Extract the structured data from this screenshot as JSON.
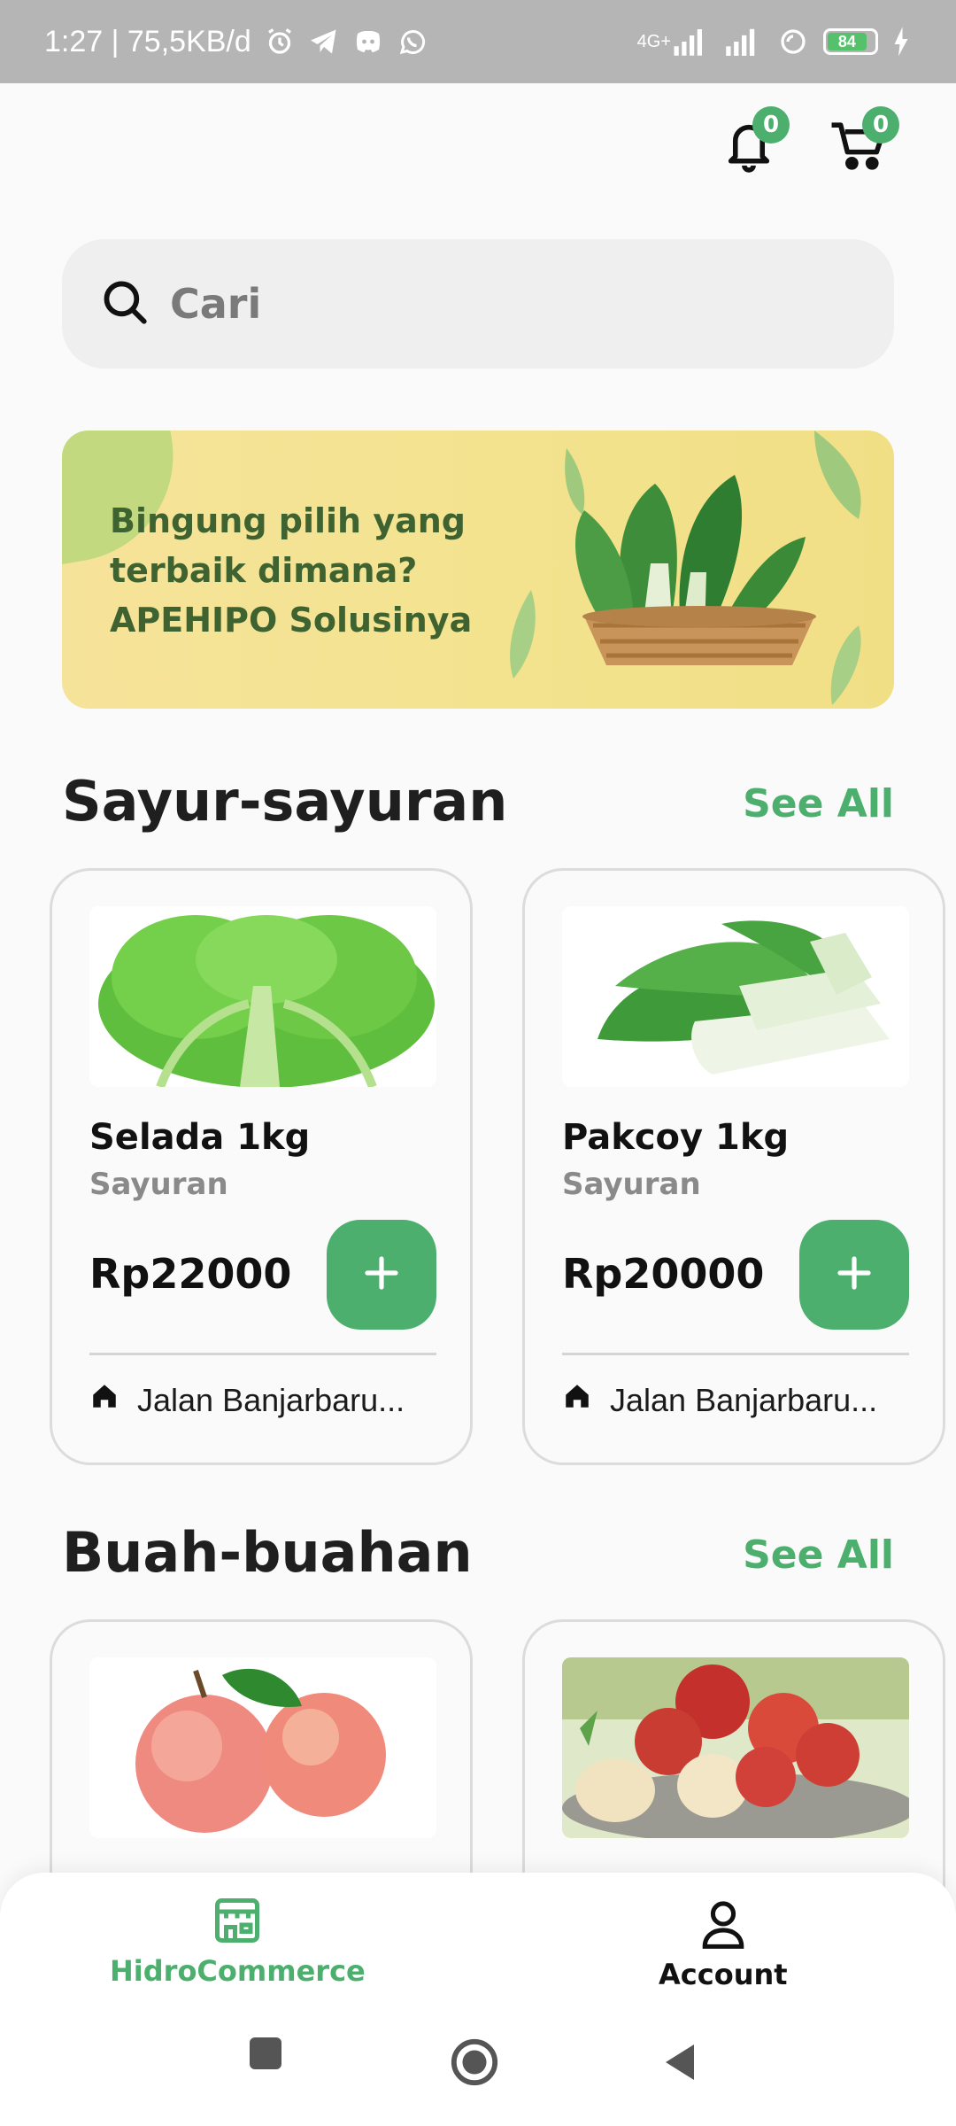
{
  "status_bar": {
    "time_speed": "1:27 | 75,5KB/d",
    "network_label": "4G+",
    "battery": "84"
  },
  "header": {
    "notification_count": "0",
    "cart_count": "0"
  },
  "search": {
    "placeholder": "Cari"
  },
  "banner": {
    "line1": "Bingung pilih yang",
    "line2": "terbaik dimana?",
    "line3": "APEHIPO Solusinya"
  },
  "sections": [
    {
      "title": "Sayur-sayuran",
      "see_all": "See All",
      "products": [
        {
          "name": "Selada 1kg",
          "category": "Sayuran",
          "price": "Rp22000",
          "location": "Jalan Banjarbaru..."
        },
        {
          "name": "Pakcoy 1kg",
          "category": "Sayuran",
          "price": "Rp20000",
          "location": "Jalan Banjarbaru..."
        }
      ]
    },
    {
      "title": "Buah-buahan",
      "see_all": "See All",
      "products": [
        {
          "name": "",
          "category": "",
          "price": "",
          "location": ""
        },
        {
          "name": "",
          "category": "",
          "price": "",
          "location": ""
        }
      ]
    }
  ],
  "bottom_nav": {
    "home_label": "HidroCommerce",
    "account_label": "Account"
  },
  "colors": {
    "accent": "#4caf6e",
    "status_bar": "#b5b5b5",
    "banner": "#f3e38e"
  }
}
